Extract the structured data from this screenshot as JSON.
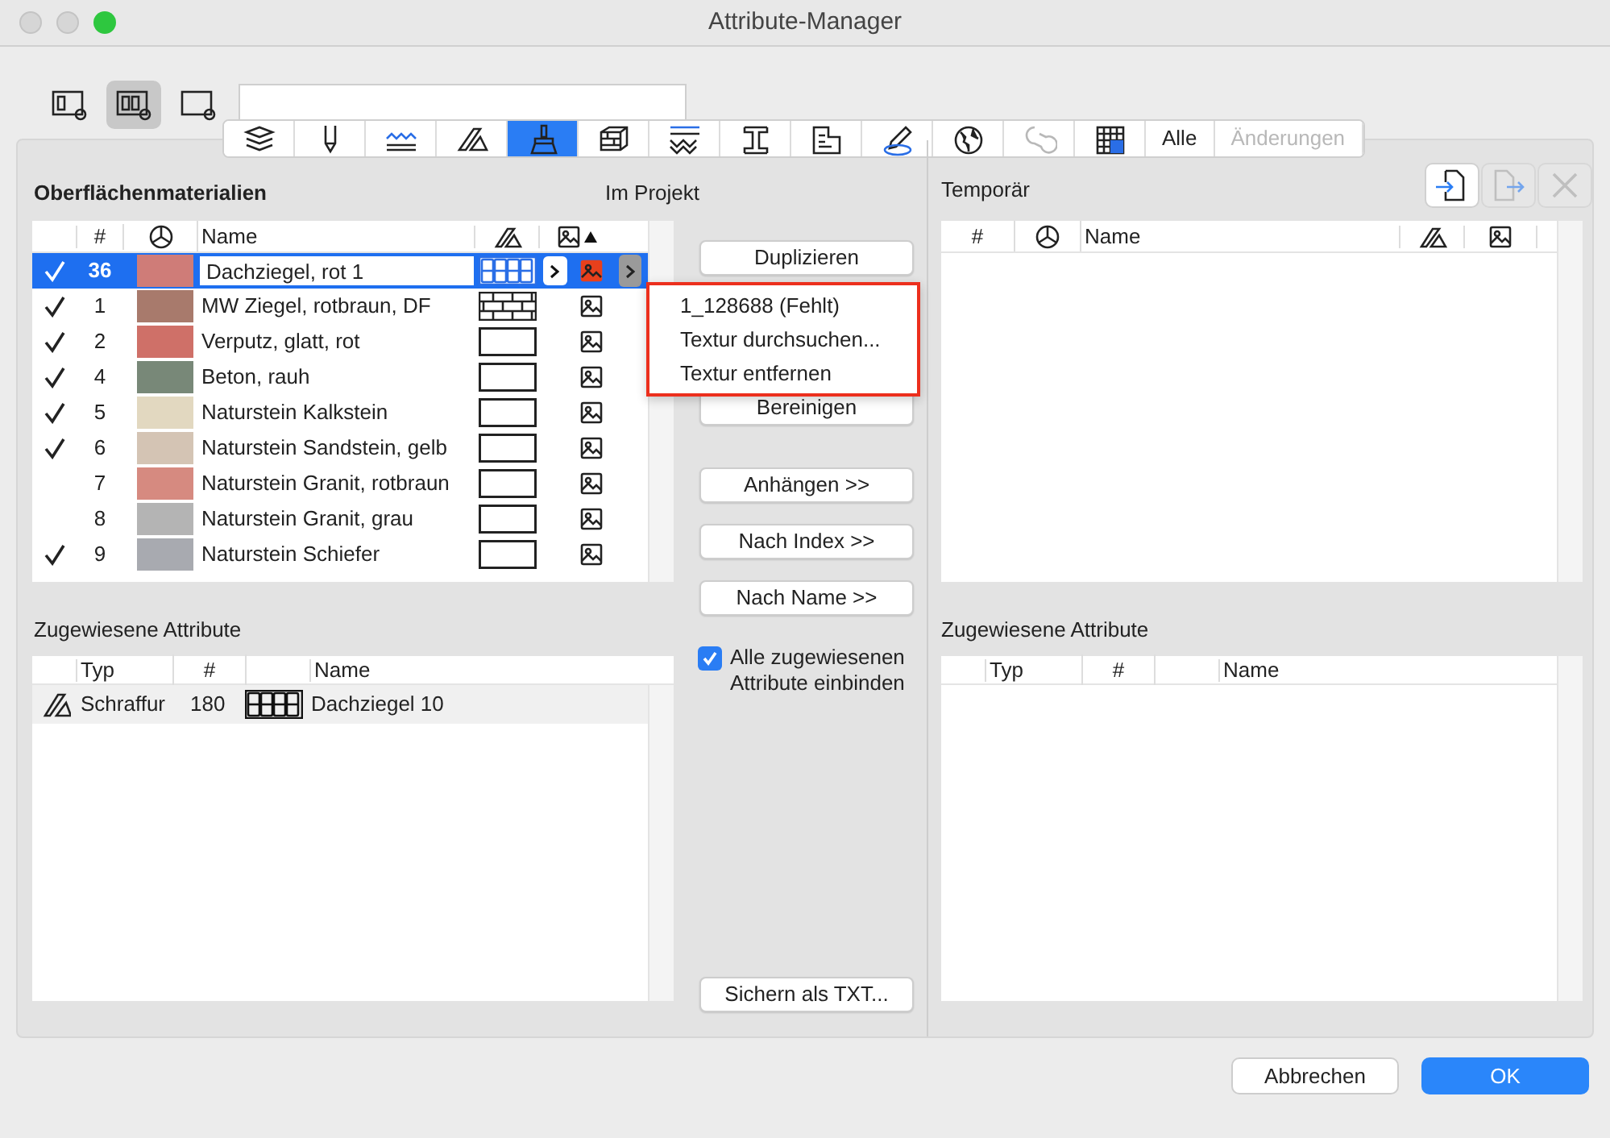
{
  "window": {
    "title": "Attribute-Manager"
  },
  "view_buttons": [
    {
      "selected": false
    },
    {
      "selected": true
    },
    {
      "selected": false
    }
  ],
  "tabs": [
    {
      "kind": "icon",
      "selected": false,
      "disabled": false
    },
    {
      "kind": "icon",
      "selected": false,
      "disabled": false
    },
    {
      "kind": "icon",
      "selected": false,
      "disabled": false
    },
    {
      "kind": "icon",
      "selected": false,
      "disabled": false
    },
    {
      "kind": "icon",
      "selected": true,
      "disabled": false
    },
    {
      "kind": "icon",
      "selected": false,
      "disabled": false
    },
    {
      "kind": "icon",
      "selected": false,
      "disabled": false
    },
    {
      "kind": "icon",
      "selected": false,
      "disabled": false
    },
    {
      "kind": "icon",
      "selected": false,
      "disabled": false
    },
    {
      "kind": "icon",
      "selected": false,
      "disabled": false
    },
    {
      "kind": "icon",
      "selected": false,
      "disabled": false
    },
    {
      "kind": "icon",
      "selected": false,
      "disabled": true
    },
    {
      "kind": "icon",
      "selected": false,
      "disabled": false
    },
    {
      "kind": "text",
      "label": "Alle",
      "selected": false,
      "disabled": false
    },
    {
      "kind": "text",
      "label": "Änderungen",
      "selected": false,
      "disabled": true
    }
  ],
  "left": {
    "title": "Oberflächenmaterialien",
    "subtitle": "Im Projekt",
    "columns": [
      "#",
      "Name"
    ],
    "rows": [
      {
        "checked": true,
        "number": "36",
        "color": "#cf7c78",
        "name": "Dachziegel, rot 1",
        "kind": "tiles",
        "texture_missing": true,
        "selected": true
      },
      {
        "checked": true,
        "number": "1",
        "color": "#a87a6c",
        "name": "MW Ziegel, rotbraun, DF",
        "kind": "bricks",
        "texture_missing": false,
        "selected": false
      },
      {
        "checked": true,
        "number": "2",
        "color": "#cf7068",
        "name": "Verputz, glatt, rot",
        "kind": "plain",
        "texture_missing": false,
        "selected": false
      },
      {
        "checked": true,
        "number": "4",
        "color": "#788878",
        "name": "Beton, rauh",
        "kind": "plain",
        "texture_missing": false,
        "selected": false
      },
      {
        "checked": true,
        "number": "5",
        "color": "#e2d8c0",
        "name": "Naturstein Kalkstein",
        "kind": "plain",
        "texture_missing": false,
        "selected": false
      },
      {
        "checked": true,
        "number": "6",
        "color": "#d4c4b4",
        "name": "Naturstein Sandstein, gelb",
        "kind": "plain",
        "texture_missing": false,
        "selected": false
      },
      {
        "checked": false,
        "number": "7",
        "color": "#d68a80",
        "name": "Naturstein Granit, rotbraun",
        "kind": "plain",
        "texture_missing": false,
        "selected": false
      },
      {
        "checked": false,
        "number": "8",
        "color": "#b4b4b4",
        "name": "Naturstein Granit, grau",
        "kind": "plain",
        "texture_missing": false,
        "selected": false
      },
      {
        "checked": true,
        "number": "9",
        "color": "#a8aab0",
        "name": "Naturstein Schiefer",
        "kind": "plain",
        "texture_missing": false,
        "selected": false
      }
    ]
  },
  "texture_menu": {
    "items": [
      "1_128688 (Fehlt)",
      "Textur durchsuchen...",
      "Textur entfernen"
    ]
  },
  "middle": {
    "top_buttons": [
      "Duplizieren",
      "Bereinigen"
    ],
    "transfer_buttons": [
      "Anhängen >>",
      "Nach Index >>",
      "Nach Name >>"
    ],
    "include_all": {
      "label": "Alle zugewiesenen Attribute einbinden",
      "checked": true
    },
    "save_button": "Sichern als TXT..."
  },
  "right": {
    "title": "Temporär",
    "columns": [
      "#",
      "Name"
    ],
    "buttons": [
      {
        "disabled": false
      },
      {
        "disabled": true
      },
      {
        "disabled": true
      }
    ]
  },
  "assigned_left": {
    "title": "Zugewiesene Attribute",
    "columns": [
      "Typ",
      "#",
      "Name"
    ],
    "rows": [
      {
        "type": "Schraffur",
        "number": "180",
        "name": "Dachziegel 10"
      }
    ]
  },
  "assigned_right": {
    "title": "Zugewiesene Attribute",
    "columns": [
      "Typ",
      "#",
      "Name"
    ]
  },
  "footer": {
    "cancel": "Abbrechen",
    "ok": "OK"
  }
}
